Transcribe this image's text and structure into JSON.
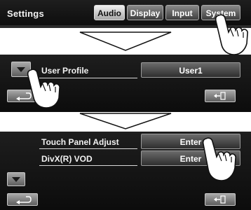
{
  "screen1": {
    "title": "Settings",
    "tabs": [
      {
        "label": "Audio",
        "active": true
      },
      {
        "label": "Display",
        "active": false
      },
      {
        "label": "Input",
        "active": false
      },
      {
        "label": "System",
        "active": false
      }
    ]
  },
  "screen2": {
    "item_label": "User Profile",
    "item_value": "User1",
    "icons": [
      "scroll-down-icon",
      "back-icon",
      "exit-icon"
    ]
  },
  "screen3": {
    "items": [
      {
        "label": "Touch Panel Adjust",
        "button": "Enter"
      },
      {
        "label": "DivX(R) VOD",
        "button": "Enter"
      }
    ],
    "icons": [
      "scroll-down-icon",
      "back-icon",
      "exit-icon"
    ]
  },
  "colors": {
    "panel": "#121212",
    "text": "#f2f2f2",
    "tab_active": "#d8d8d8"
  }
}
